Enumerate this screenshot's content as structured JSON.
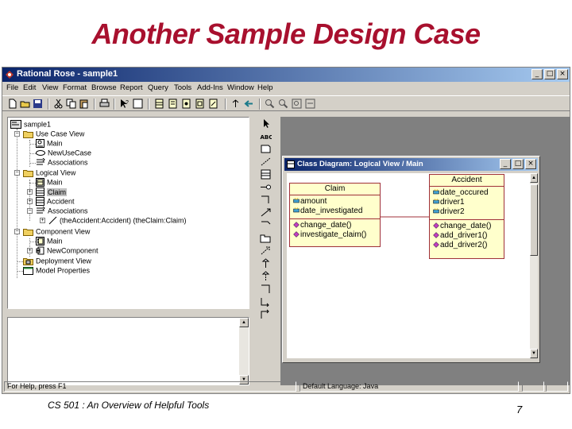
{
  "slide": {
    "title": "Another Sample Design Case",
    "footer_left": "CS 501 : An Overview of Helpful Tools",
    "page_number": "7"
  },
  "window": {
    "title": "Rational Rose - sample1",
    "buttons": [
      "minimize",
      "maximize",
      "close"
    ]
  },
  "menu": [
    "File",
    "Edit",
    "View",
    "Format",
    "Browse",
    "Report",
    "Query",
    "Tools",
    "Add-Ins",
    "Window",
    "Help"
  ],
  "tree": {
    "root": "sample1",
    "use_case_view": "Use Case View",
    "ucv_main": "Main",
    "new_use_case": "NewUseCase",
    "ucv_associations": "Associations",
    "logical_view": "Logical View",
    "lv_main": "Main",
    "claim": "Claim",
    "accident": "Accident",
    "lv_associations": "Associations",
    "association_item": "(theAccident:Accident) (theClaim:Claim)",
    "component_view": "Component View",
    "cv_main": "Main",
    "new_component": "NewComponent",
    "deployment_view": "Deployment View",
    "model_properties": "Model Properties"
  },
  "diagram_window": {
    "title": "Class Diagram: Logical View / Main"
  },
  "classes": {
    "claim": {
      "name": "Claim",
      "attributes": [
        "amount",
        "date_investigated"
      ],
      "operations": [
        "change_date()",
        "investigate_claim()"
      ]
    },
    "accident": {
      "name": "Accident",
      "attributes": [
        "date_occured",
        "driver1",
        "driver2"
      ],
      "operations": [
        "change_date()",
        "add_driver1()",
        "add_driver2()"
      ]
    }
  },
  "status": {
    "help_text": "For Help, press F1",
    "language": "Default Language: Java"
  },
  "colors": {
    "title_red": "#a8102e",
    "class_fill": "#ffffcc",
    "class_border": "#a0303a",
    "titlebar_start": "#0a246a"
  }
}
